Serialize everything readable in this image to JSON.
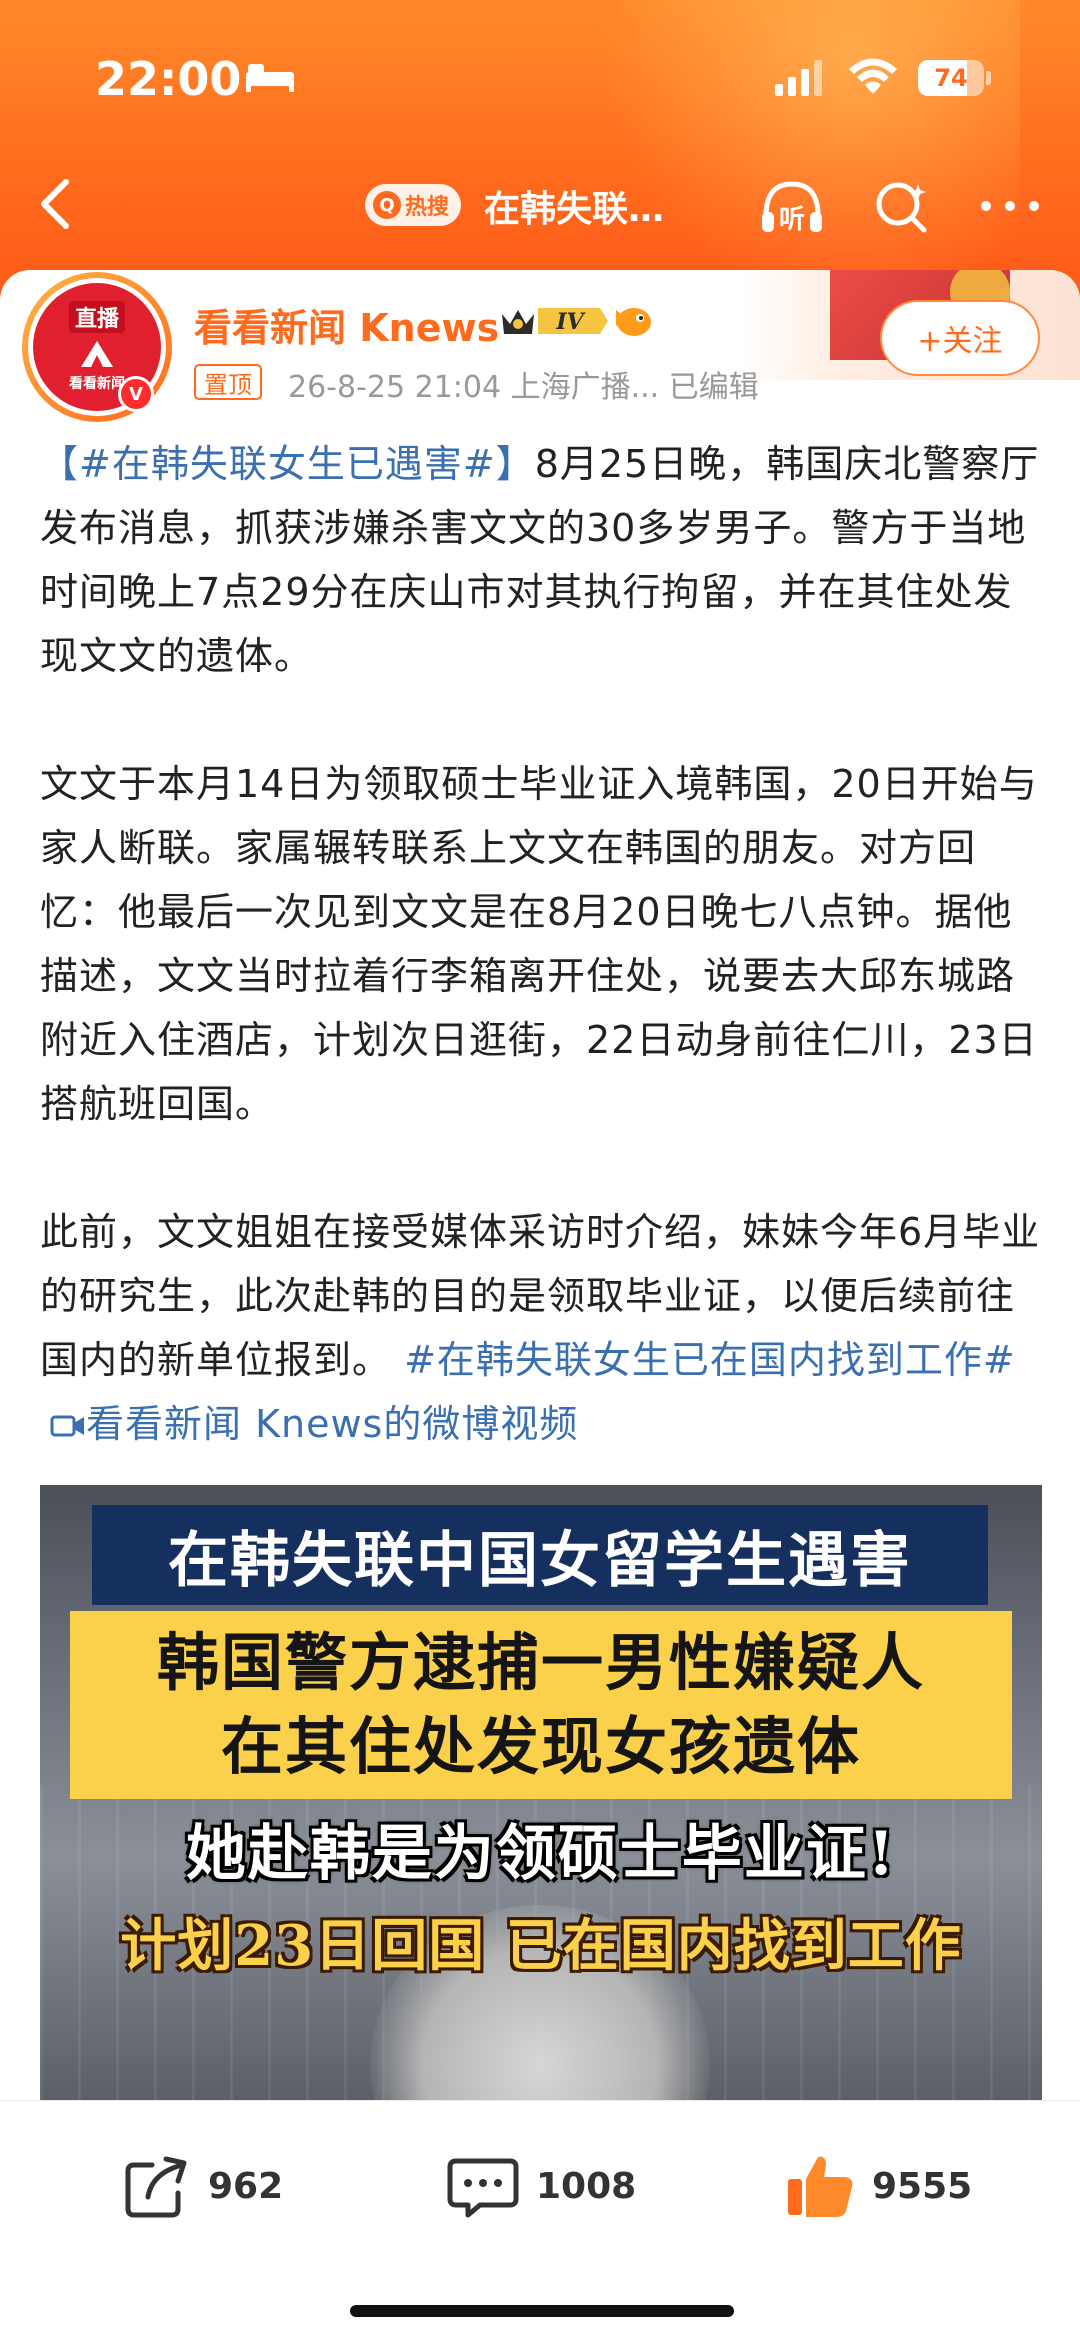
{
  "status_bar": {
    "time": "22:00",
    "battery_percent": 74,
    "battery_label": "74"
  },
  "nav": {
    "hot_label": "热搜",
    "title": "在韩失联…"
  },
  "author": {
    "avatar_live_label": "直播",
    "avatar_brand": "看看新闻",
    "name": "看看新闻 Knews",
    "vip_level": "IV",
    "pin_label": "置顶",
    "meta": "26-8-25 21:04  上海广播...  已编辑",
    "follow_label": "+关注"
  },
  "post": {
    "p1_hashtag": "【#在韩失联女生已遇害#】",
    "p1_text": "8月25日晚，韩国庆北警察厅发布消息，抓获涉嫌杀害文文的30多岁男子。警方于当地时间晚上7点29分在庆山市对其执行拘留，并在其住处发现文文的遗体。",
    "p2_text": "文文于本月14日为领取硕士毕业证入境韩国，20日开始与家人断联。家属辗转联系上文文在韩国的朋友。对方回忆：他最后一次见到文文是在8月20日晚七八点钟。据他描述，文文当时拉着行李箱离开住处，说要去大邱东城路附近入住酒店，计划次日逛街，22日动身前往仁川，23日搭航班回国。",
    "p3_text": "此前，文文姐姐在接受媒体采访时介绍，妹妹今年6月毕业的研究生，此次赴韩的目的是领取毕业证，以便后续前往国内的新单位报到。",
    "p3_hashtag": " #在韩失联女生已在国内找到工作#",
    "video_link": "看看新闻 Knews的微博视频"
  },
  "video": {
    "line1": "在韩失联中国女留学生遇害",
    "line2a": "韩国警方逮捕一男性嫌疑人",
    "line2b": "在其住处发现女孩遗体",
    "line3": "她赴韩是为领硕士毕业证!",
    "line4": "计划23日回国 已在国内找到工作"
  },
  "actions": {
    "share_count": "962",
    "comment_count": "1008",
    "like_count": "9555"
  },
  "colors": {
    "accent": "#ff6a1c",
    "link": "#3a6fb0",
    "video_banner": "#15305e",
    "video_highlight": "#fbd04a"
  }
}
